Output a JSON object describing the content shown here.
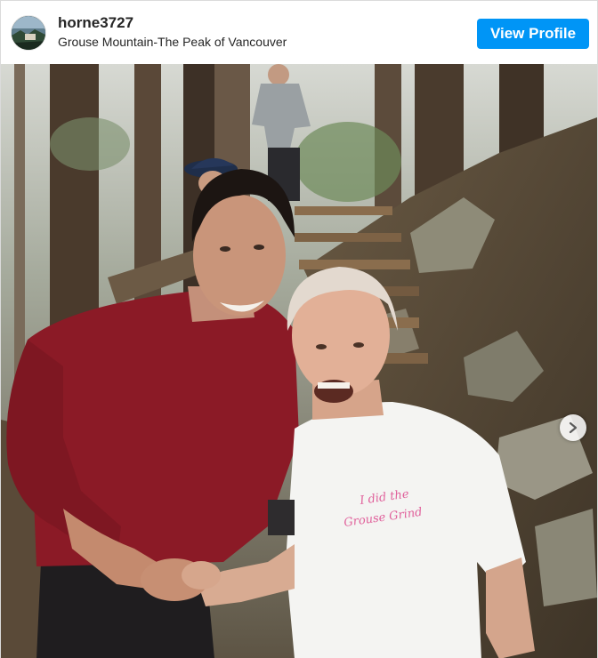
{
  "post": {
    "username": "horne3727",
    "location": "Grouse Mountain-The Peak of Vancouver",
    "view_profile_label": "View Profile"
  },
  "photo": {
    "shirt_print": [
      "I did the",
      "Grouse Grind"
    ]
  },
  "icons": {
    "avatar": "profile-avatar",
    "next": "chevron-right-icon"
  },
  "colors": {
    "button": "#0095f6",
    "text": "#262626"
  }
}
